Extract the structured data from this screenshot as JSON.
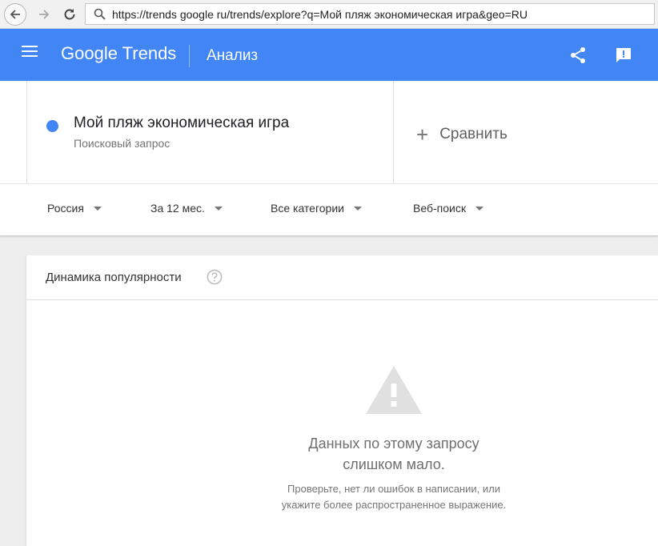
{
  "browser": {
    "url": "https://trends google ru/trends/explore?q=Мой пляж экономическая игра&geo=RU"
  },
  "header": {
    "brand": "Google Trends",
    "section": "Анализ"
  },
  "term": {
    "name": "Мой пляж экономическая игра",
    "type": "Поисковый запрос",
    "color": "#4285f4"
  },
  "compare": {
    "label": "Сравнить"
  },
  "filters": [
    {
      "label": "Россия"
    },
    {
      "label": "За 12 мес."
    },
    {
      "label": "Все категории"
    },
    {
      "label": "Веб-поиск"
    }
  ],
  "interest": {
    "title": "Динамика популярности",
    "empty_title_line1": "Данных по этому запросу",
    "empty_title_line2": "слишком мало.",
    "empty_hint_line1": "Проверьте, нет ли ошибок в написании, или",
    "empty_hint_line2": "укажите более распространенное выражение."
  },
  "icons": {
    "back": "back-arrow-icon",
    "forward": "forward-arrow-icon",
    "reload": "reload-icon",
    "search": "search-icon",
    "menu": "menu-icon",
    "share": "share-icon",
    "feedback": "feedback-icon",
    "help": "help-icon",
    "warning": "warning-icon"
  },
  "colors": {
    "accent": "#4285f4"
  }
}
